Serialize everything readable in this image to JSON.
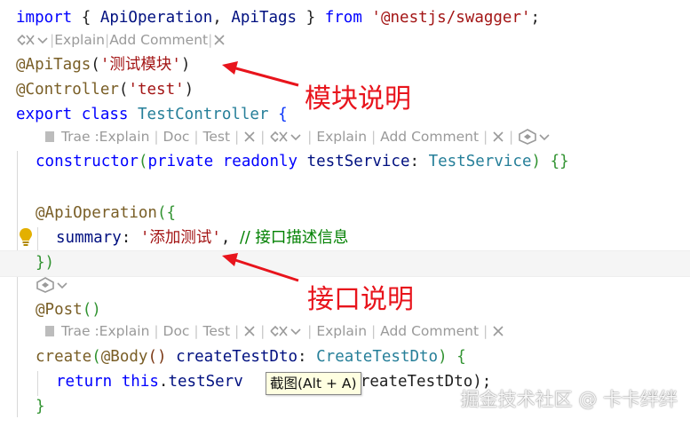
{
  "editor": {
    "line_import": {
      "kw1": "import",
      "p1": " { ",
      "id1": "ApiOperation",
      "p2": ", ",
      "id2": "ApiTags",
      "p3": " } ",
      "kw2": "from",
      "sp": " ",
      "str": "'@nestjs/swagger'",
      "end": ";"
    },
    "lens_import": {
      "items": [
        "Explain",
        "Add Comment"
      ],
      "sep": "|"
    },
    "line_apitags": {
      "dec": "@ApiTags",
      "open": "(",
      "str": "'测试模块'",
      "close": ")"
    },
    "line_controller": {
      "dec": "@Controller",
      "open": "(",
      "str": "'test'",
      "close": ")"
    },
    "line_class": {
      "kw1": "export",
      "kw2": "class",
      "name": "TestController",
      "brace": "{"
    },
    "lens_class": {
      "items": [
        "Trae :Explain",
        "Doc",
        "Test",
        "Explain",
        "Add Comment"
      ]
    },
    "line_ctor": {
      "kw": "constructor",
      "open": "(",
      "mod1": "private",
      "mod2": "readonly",
      "param": "testService",
      "colon": ": ",
      "type": "TestService",
      "close": ")",
      "body": "{}"
    },
    "line_apiop": {
      "dec": "@ApiOperation",
      "open": "({"
    },
    "line_summary": {
      "key": "summary",
      "colon": ": ",
      "str": "'添加测试'",
      "comma": ", ",
      "comment": "// 接口描述信息"
    },
    "line_close": {
      "text": "})"
    },
    "line_post": {
      "dec": "@Post",
      "parens": "()"
    },
    "lens_post": {
      "items": [
        "Trae :Explain",
        "Doc",
        "Test",
        "Explain",
        "Add Comment"
      ]
    },
    "line_create": {
      "fn": "create",
      "open": "(",
      "dec": "@Body",
      "parens": "()",
      "param": "createTestDto",
      "colon": ": ",
      "type": "CreateTestDto",
      "close": ")",
      "brace": "{"
    },
    "line_return": {
      "kw": "return",
      "this": "this",
      "dot1": ".",
      "prop": "testServ",
      "rest": "(createTestDto);"
    },
    "line_end": {
      "text": "}"
    }
  },
  "annotations": {
    "module": "模块说明",
    "api": "接口说明"
  },
  "tooltip": "截图(Alt + A)",
  "watermark": "掘金技术社区 @ 卡卡绊绊",
  "colors": {
    "keyword": "#0000ff",
    "string": "#a31515",
    "type": "#267f99",
    "variable": "#001080",
    "function": "#795e26",
    "comment": "#008000",
    "annotation": "#e8141c",
    "lens": "#9a9a9a"
  },
  "icons": [
    "diff-icon",
    "chevron-down-icon",
    "close-icon",
    "trae-logo-icon",
    "lightbulb-icon",
    "arrow-icon"
  ]
}
